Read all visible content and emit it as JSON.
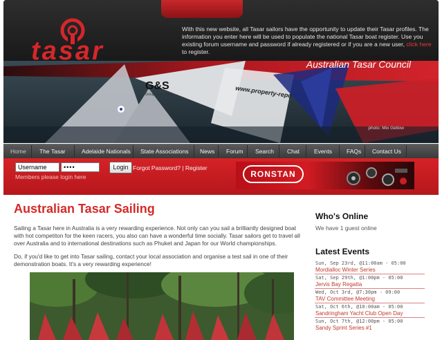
{
  "header": {
    "logo_text": "tasar",
    "intro_text": "With this new website, all Tasar sailors have the opportunity to update their Tasar profiles. The information you enter here will be used to populate the national Tasar boat register. Use you existing forum username and password if already registered or if you are a new user,",
    "intro_link": "click here",
    "intro_tail": " to register.",
    "council": "Australian Tasar Council",
    "sponsor_sail": "G&S",
    "sponsor_sail_sub": "Group 4 Securicor",
    "boat_url": "www.property-repo",
    "photo_credit": "photo: Mix Gellow"
  },
  "nav": {
    "items": [
      "Home",
      "The Tasar",
      "Adelaide Nationals",
      "State Associations",
      "News",
      "Forum",
      "Search",
      "Chat",
      "Events",
      "FAQs",
      "Contact Us"
    ]
  },
  "login": {
    "username_value": "Username",
    "password_value": "••••",
    "button": "Login",
    "forgot": "Forgot Password?",
    "separator": " | ",
    "register": "Register",
    "members_note": "Members please login here"
  },
  "ad": {
    "brand": "RONSTAN"
  },
  "main": {
    "title": "Australian Tasar Sailing",
    "paragraph1": "Sailing a Tasar here in Australia is a very rewarding experience. Not only can you sail a brilliantly designed boat with hot competiton for the keen racers, you also can have a wonderful time socially. Tasar sailors get to travel all over Australia and to international destinations such as Phuket and Japan for our World championships.",
    "paragraph2": "Do, if you'd like to get into Tasar sailing, contact your local association and organise a test sail in one of their demonstration boats. It's a very rewarding experience!"
  },
  "sidebar": {
    "who_heading": "Who's Online",
    "guests": "We have 1 guest online",
    "events_heading": "Latest Events",
    "events": [
      {
        "date": "Sun, Sep 23rd, @11:00am - 05:00",
        "title": "Mordialloc Winter Series"
      },
      {
        "date": "Sat, Sep 29th, @1:00pm - 05:00",
        "title": "Jervis Bay Regatta"
      },
      {
        "date": "Wed, Oct 3rd, @7:30pm - 09:00",
        "title": "TAV Committee Meeting"
      },
      {
        "date": "Sat, Oct 6th, @10:00am - 05:00",
        "title": "Sandringham Yacht Club Open Day"
      },
      {
        "date": "Sun, Oct 7th, @12:00pm - 05:00",
        "title": "Sandy Sprint Series #1"
      }
    ]
  },
  "colors": {
    "brand_red": "#d52a2a",
    "header_dark": "#1c1c1c",
    "nav_grey": "#4a4a4a"
  }
}
